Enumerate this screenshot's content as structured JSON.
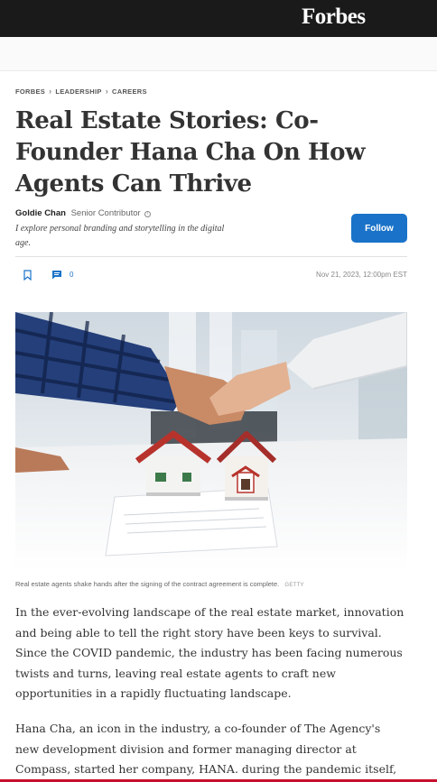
{
  "header": {
    "logo": "Forbes"
  },
  "breadcrumb": {
    "items": [
      "FORBES",
      "LEADERSHIP",
      "CAREERS"
    ],
    "separator": "›"
  },
  "article": {
    "title": "Real Estate Stories: Co-Founder Hana Cha On How Agents Can Thrive",
    "author": {
      "name": "Goldie Chan",
      "role": "Senior Contributor",
      "bio": "I explore personal branding and storytelling in the digital age."
    },
    "follow_label": "Follow",
    "comment_count": "0",
    "date": "Nov 21, 2023, 12:00pm EST",
    "image": {
      "caption": "Real estate agents shake hands after the signing of the contract agreement is complete.",
      "credit": "GETTY"
    },
    "paragraphs": [
      "In the ever-evolving landscape of the real estate market, innovation and being able to tell the right story have been keys to survival. Since the COVID pandemic, the industry has been facing numerous twists and turns, leaving real estate agents to craft new opportunities in a rapidly fluctuating landscape.",
      "Hana Cha, an icon in the industry, a co-founder of The Agency's new development division and former managing director at Compass, started her company, HANA. during the pandemic itself, and since then she has"
    ]
  },
  "colors": {
    "accent": "#1a73c8",
    "topbar": "#1a1a1a",
    "bottom_accent": "#c8102e"
  },
  "icons": {
    "bookmark": "bookmark-icon",
    "comment": "comment-icon",
    "info": "info-icon"
  }
}
